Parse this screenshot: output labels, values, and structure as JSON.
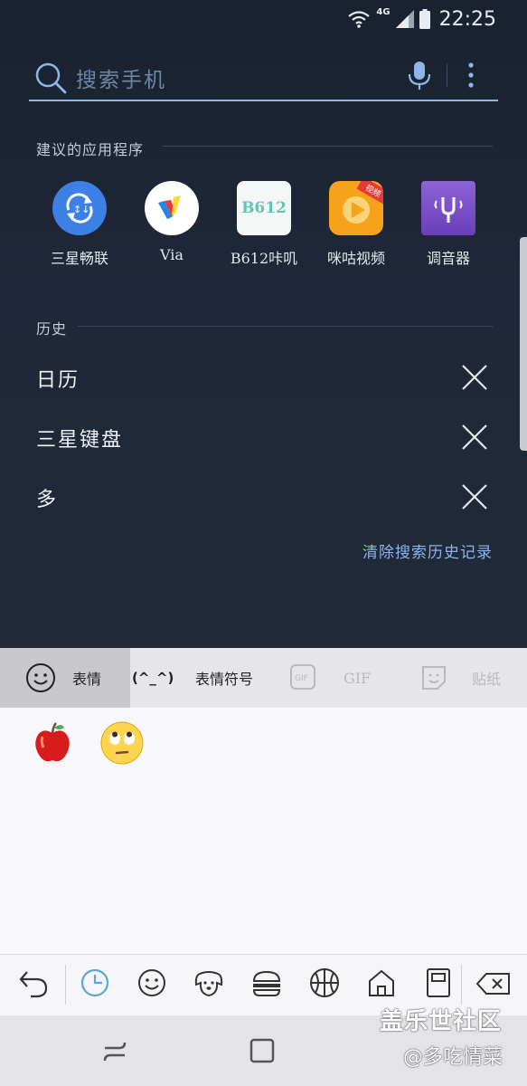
{
  "status_bar": {
    "network": "4G",
    "time": "22:25"
  },
  "search": {
    "placeholder": "搜索手机"
  },
  "suggested": {
    "header": "建议的应用程序",
    "apps": [
      {
        "label": "三星畅联",
        "icon": "samsung-connect-icon"
      },
      {
        "label": "Via",
        "icon": "via-browser-icon"
      },
      {
        "label": "B612咔叽",
        "icon": "b612-icon",
        "icon_text": "B612"
      },
      {
        "label": "咪咕视频",
        "icon": "migu-video-icon",
        "badge": "视频"
      },
      {
        "label": "调音器",
        "icon": "tuner-fork-icon"
      }
    ]
  },
  "history": {
    "header": "历史",
    "items": [
      "日历",
      "三星键盘",
      "多"
    ],
    "clear_label": "清除搜索历史记录"
  },
  "keyboard": {
    "tabs": [
      {
        "label": "表情",
        "active": true
      },
      {
        "label": "(^_^)"
      },
      {
        "label": "表情符号"
      },
      {
        "label": "GIF",
        "dim": true
      },
      {
        "label": "贴纸",
        "dim": true
      }
    ],
    "recent_emojis": [
      "red-apple-emoji",
      "face-with-rolling-eyes-emoji"
    ],
    "categories": [
      "undo-icon",
      "clock-icon",
      "smiley-icon",
      "dog-icon",
      "burger-icon",
      "basketball-icon",
      "house-icon",
      "book-icon",
      "backspace-icon"
    ]
  },
  "watermark": {
    "line1": "盖乐世社区",
    "line2": "@多吃情菜"
  },
  "colors": {
    "accent": "#8fb6ea",
    "clear_link": "#8ab4f0",
    "kb_active": "#c8c8cc",
    "icon_blue": "#5ba7d6"
  }
}
